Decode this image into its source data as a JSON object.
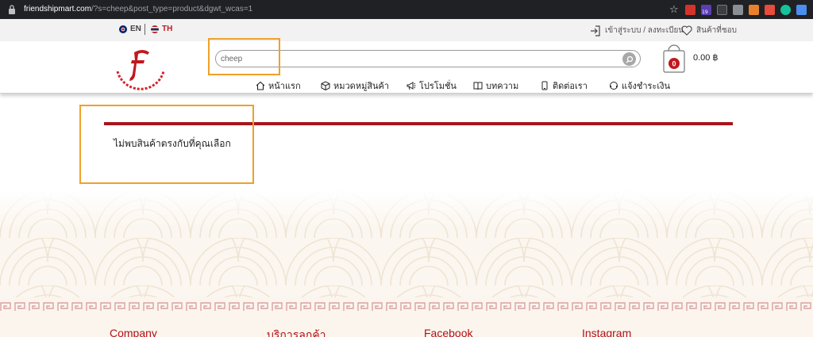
{
  "browser": {
    "url_host": "friendshipmart.com",
    "url_path": "/?s=cheep&post_type=product&dgwt_wcas=1",
    "extension_badge": "19"
  },
  "topbar": {
    "lang_en": "EN",
    "lang_th": "TH",
    "login_link": "เข้าสู่ระบบ / ลงทะเบียน",
    "wishlist_link": "สินค้าที่ชอบ"
  },
  "header": {
    "search_value": "cheep",
    "cart_count": "0",
    "cart_total": "0.00 ฿"
  },
  "nav": {
    "items": [
      {
        "label": "หน้าแรก",
        "icon": "home-icon"
      },
      {
        "label": "หมวดหมู่สินค้า",
        "icon": "box-icon"
      },
      {
        "label": "โปรโมชั่น",
        "icon": "megaphone-icon"
      },
      {
        "label": "บทความ",
        "icon": "book-icon"
      },
      {
        "label": "ติดต่อเรา",
        "icon": "phone-icon"
      },
      {
        "label": "แจ้งชำระเงิน",
        "icon": "headset-icon"
      }
    ]
  },
  "content": {
    "no_results": "ไม่พบสินค้าตรงกับที่คุณเลือก"
  },
  "footer": {
    "columns": [
      "Company",
      "บริการลูกค้า",
      "Facebook",
      "Instagram"
    ]
  },
  "colors": {
    "brand_red": "#a8141a",
    "highlight": "#f0a02a"
  }
}
